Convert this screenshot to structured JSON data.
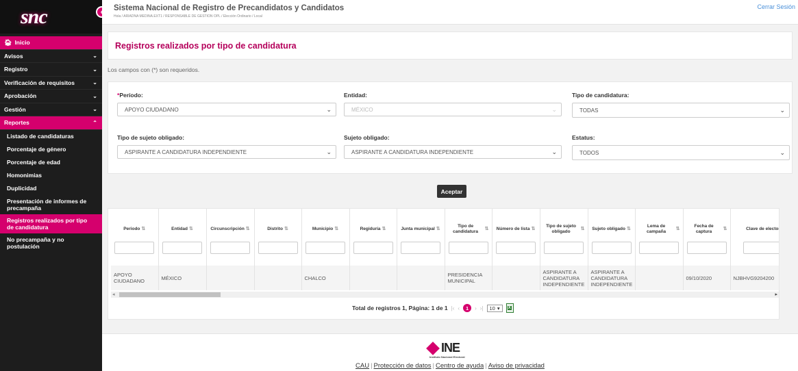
{
  "sidebar": {
    "logo": "snc",
    "collapse_icon": "‹",
    "items": [
      {
        "label": "Inicio",
        "active": true
      },
      {
        "label": "Avisos"
      },
      {
        "label": "Registro"
      },
      {
        "label": "Verificación de requisitos"
      },
      {
        "label": "Aprobación"
      },
      {
        "label": "Gestión"
      },
      {
        "label": "Reportes",
        "active": true
      }
    ],
    "subitems": [
      "Listado de candidaturas",
      "Porcentaje de género",
      "Porcentaje de edad",
      "Homonimias",
      "Duplicidad",
      "Presentación de informes de precampaña",
      "Registros realizados por tipo de candidatura",
      "No precampaña y no postulación"
    ]
  },
  "header": {
    "title": "Sistema Nacional de Registro de Precandidatos y Candidatos",
    "subtitle": "Hola / ARIADNA MEDINA.EXT1 / RESPONSABLE DE GESTION OPL / Elección Ordinario / Local",
    "logout": "Cerrar Sesión"
  },
  "page": {
    "title": "Registros realizados por tipo de candidatura",
    "required_note": "Los campos con (*) son requeridos."
  },
  "filters": {
    "periodo": {
      "label": "Período:",
      "value": "APOYO CIUDADANO"
    },
    "entidad": {
      "label": "Entidad:",
      "value": "MÉXICO"
    },
    "tipo_candidatura": {
      "label": "Tipo de candidatura:",
      "value": "TODAS"
    },
    "tipo_sujeto": {
      "label": "Tipo de sujeto obligado:",
      "value": "ASPIRANTE A CANDIDATURA INDEPENDIENTE"
    },
    "sujeto": {
      "label": "Sujeto obligado:",
      "value": "ASPIRANTE A CANDIDATURA INDEPENDIENTE"
    },
    "estatus": {
      "label": "Estatus:",
      "value": "TODOS"
    },
    "accept": "Aceptar"
  },
  "table": {
    "columns": [
      "Periodo",
      "Entidad",
      "Circunscripción",
      "Distrito",
      "Municipio",
      "Regiduría",
      "Junta municipal",
      "Tipo de candidatura",
      "Número de lista",
      "Tipo de sujeto obligado",
      "Sujeto obligado",
      "Lema de campaña",
      "Fecha de captura",
      "Clave de elector"
    ],
    "rows": [
      [
        "APOYO CIUDADANO",
        "MÉXICO",
        "",
        "",
        "CHALCO",
        "",
        "",
        "PRESIDENCIA MUNICIPAL",
        "",
        "ASPIRANTE A CANDIDATURA INDEPENDIENTE",
        "ASPIRANTE A CANDIDATURA INDEPENDIENTE",
        "",
        "09/10/2020",
        "NJBHVG9204200"
      ]
    ],
    "pager": {
      "total": "Total de registros 1, Página: 1 de 1",
      "current": "1",
      "page_size": "10"
    }
  },
  "footer": {
    "logo": "INE",
    "logo_sub": "Instituto Nacional Electoral",
    "links": [
      "CAU",
      "Protección de datos",
      "Centro de ayuda",
      "Aviso de privacidad"
    ]
  },
  "colors": {
    "accent": "#d5006d",
    "sidebar": "#1d1d1d"
  }
}
